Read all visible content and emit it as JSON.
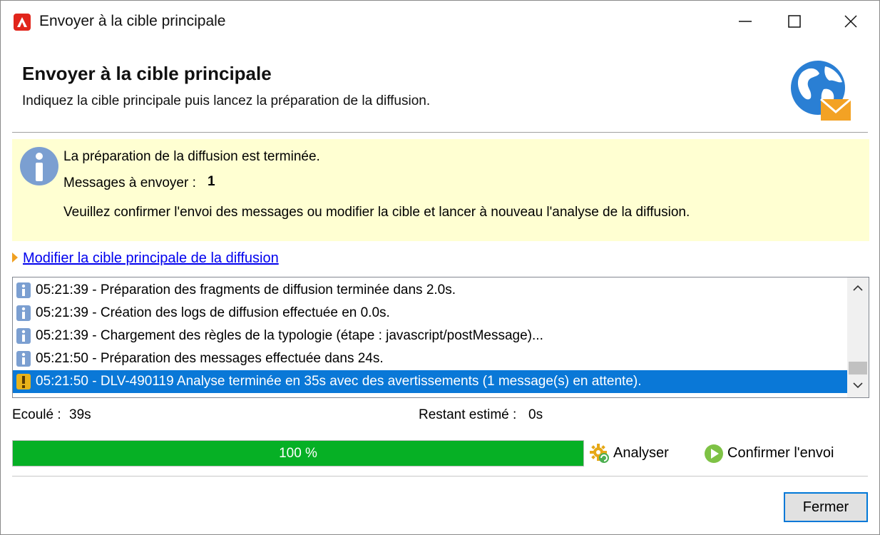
{
  "window": {
    "title": "Envoyer à la cible principale"
  },
  "header": {
    "title": "Envoyer à la cible principale",
    "subtitle": "Indiquez la cible principale puis lancez la préparation de la diffusion.",
    "icon": "globe-envelope-icon"
  },
  "info": {
    "line1": "La préparation de la diffusion est terminée.",
    "count_label": "Messages à envoyer :",
    "count_value": "1",
    "line3": "Veuillez confirmer l'envoi des messages ou modifier la cible et lancer à nouveau l'analyse de la diffusion."
  },
  "link": {
    "label": "Modifier la cible principale de la diffusion"
  },
  "log": {
    "rows": [
      {
        "type": "info",
        "text": "05:21:39 - Préparation des fragments de diffusion terminée dans 2.0s."
      },
      {
        "type": "info",
        "text": "05:21:39 - Création des logs de diffusion effectuée en 0.0s."
      },
      {
        "type": "info",
        "text": "05:21:39 - Chargement des règles de la typologie (étape : javascript/postMessage)..."
      },
      {
        "type": "info",
        "text": "05:21:50 - Préparation des messages effectuée dans 24s."
      },
      {
        "type": "warning",
        "text": "05:21:50 - DLV-490119 Analyse terminée en 35s avec des avertissements (1 message(s) en attente).",
        "selected": true
      }
    ]
  },
  "stats": {
    "elapsed_label": "Ecoulé :",
    "elapsed_value": "39s",
    "remaining_label": "Restant estimé :",
    "remaining_value": "0s"
  },
  "progress": {
    "value": 100,
    "label": "100 %",
    "color": "#06b025"
  },
  "actions": {
    "analyze_label": "Analyser",
    "confirm_label": "Confirmer l'envoi"
  },
  "footer": {
    "close_label": "Fermer"
  },
  "colors": {
    "accent": "#0078d7",
    "selection": "#0a78d7",
    "info_panel": "#ffffd2",
    "app_icon": "#e1251b"
  }
}
